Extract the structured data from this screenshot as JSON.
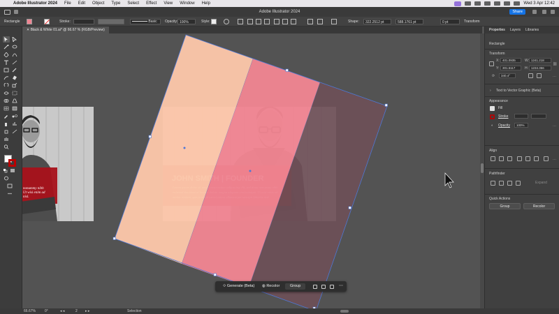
{
  "menubar": {
    "app_name": "Adobe Illustrator 2024",
    "items": [
      "File",
      "Edit",
      "Object",
      "Type",
      "Select",
      "Effect",
      "View",
      "Window",
      "Help"
    ],
    "datetime": "Wed 3 Apr  12:42"
  },
  "titlebar": {
    "title": "Adobe Illustrator 2024",
    "share_label": "Share"
  },
  "controlbar": {
    "selection_type": "Rectangle",
    "stroke_label": "Stroke:",
    "brush_label": "Basic",
    "opacity_label": "Opacity:",
    "opacity_value": "100%",
    "style_label": "Style:",
    "shape_label": "Shape:",
    "shape_width": "322.2512 pt",
    "shape_height": "588.1761 pt",
    "corner_value": "0 pt",
    "transform_label": "Transform"
  },
  "document": {
    "tab_label": "Black & White 01.ai* @ 66.67 % (RGB/Preview)"
  },
  "artboards": {
    "headline": "JOHN SMITH | FOUNDER",
    "body_text": "Lorem ipsum dolor sit amet, consectetuer adipiscing elit, sed diam nonummy nibh euismod tincidunt ut laoreet dolore magna aliquam erat volutpat. Ut wisi enim ad minim veniam, quis nostrud exerci tation ullamcorper suscipit lobortis nisl.",
    "left_body_text": "nonummy nibh Ut wisi enim ad nisl."
  },
  "shapes": {
    "colors": {
      "peach": "#fbc6a9",
      "pink": "#f08592",
      "plum": "#6e5058",
      "banner_red": "#b30d14",
      "selection_blue": "#4d78d6"
    }
  },
  "taskbar": {
    "generate_label": "Generate (Beta)",
    "recolor_label": "Recolor",
    "group_label": "Group"
  },
  "statusbar": {
    "zoom": "66.67%",
    "rotation": "0°",
    "artboard_number": "2",
    "tool_name": "Selection"
  },
  "panel": {
    "tabs": [
      "Properties",
      "Layers",
      "Libraries"
    ],
    "selection_type": "Rectangle",
    "transform_title": "Transform",
    "x_value": "401.0935",
    "w_value": "1241.218",
    "y_value": "301.5117",
    "h_value": "1234.356",
    "rotation_value": "340.4°",
    "text_to_vector": "Text to Vector Graphic (Beta)",
    "appearance_title": "Appearance",
    "fill_label": "Fill",
    "stroke_label": "Stroke",
    "opacity_label": "Opacity",
    "opacity_value": "100%",
    "align_title": "Align",
    "pathfinder_title": "Pathfinder",
    "expand_label": "Expand",
    "quick_actions_title": "Quick Actions",
    "group_button": "Group",
    "recolor_button": "Recolor"
  }
}
